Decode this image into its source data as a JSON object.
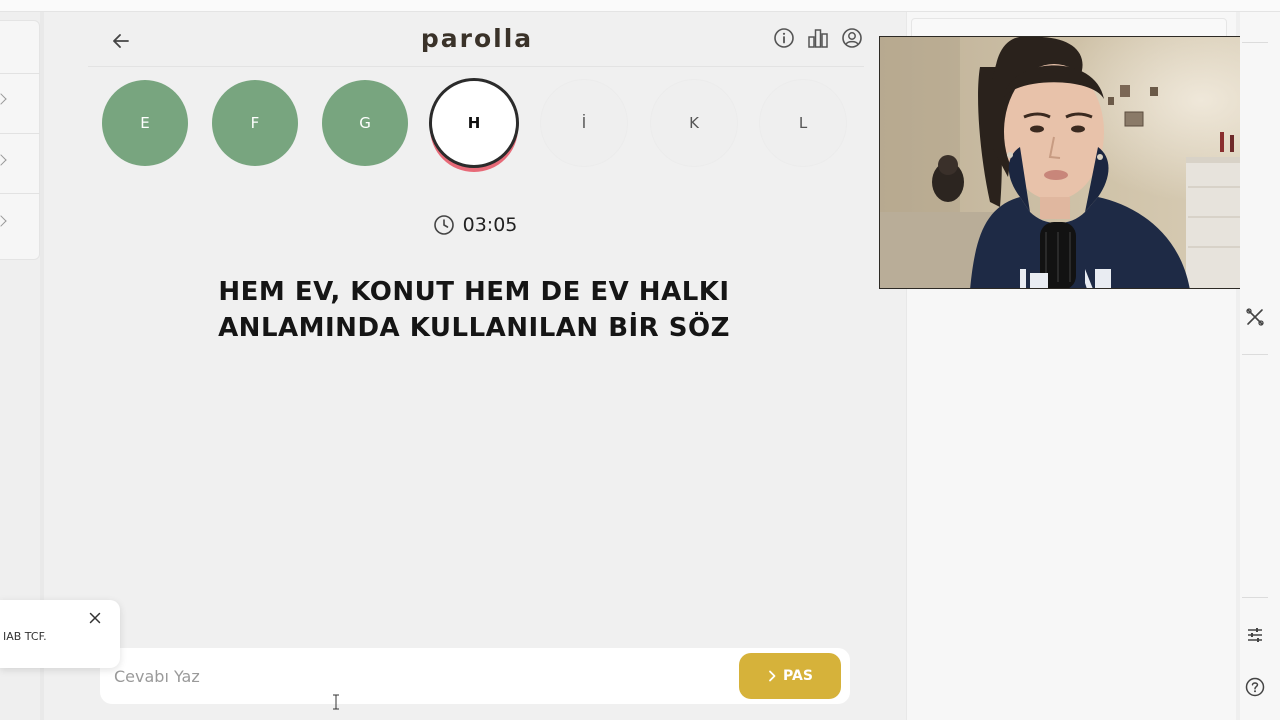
{
  "app": {
    "logo": "parolla"
  },
  "header": {
    "icons": [
      "back-arrow-icon",
      "info-icon",
      "stats-icon",
      "account-icon"
    ]
  },
  "letters": [
    {
      "letter": "E",
      "state": "done"
    },
    {
      "letter": "F",
      "state": "done"
    },
    {
      "letter": "G",
      "state": "done"
    },
    {
      "letter": "H",
      "state": "current"
    },
    {
      "letter": "İ",
      "state": "upcoming"
    },
    {
      "letter": "K",
      "state": "upcoming"
    },
    {
      "letter": "L",
      "state": "upcoming"
    }
  ],
  "timer": {
    "icon": "clock-icon",
    "value": "03:05"
  },
  "question": {
    "line1": "HEM EV, KONUT HEM DE EV HALKI",
    "line2": "ANLAMINDA KULLANILAN BİR SÖZ"
  },
  "answer": {
    "placeholder": "Cevabı Yaz",
    "value": "",
    "pass_label": "PAS"
  },
  "toast": {
    "text": "IAB TCF."
  },
  "colors": {
    "done": "#78a57f",
    "current_ring": "#2b2b2b",
    "current_accent": "#e76a78",
    "pass_button": "#d6b23a",
    "logo": "#3a3229"
  },
  "right_rail": {
    "icons": [
      "tools-icon",
      "sliders-icon",
      "help-icon"
    ]
  }
}
